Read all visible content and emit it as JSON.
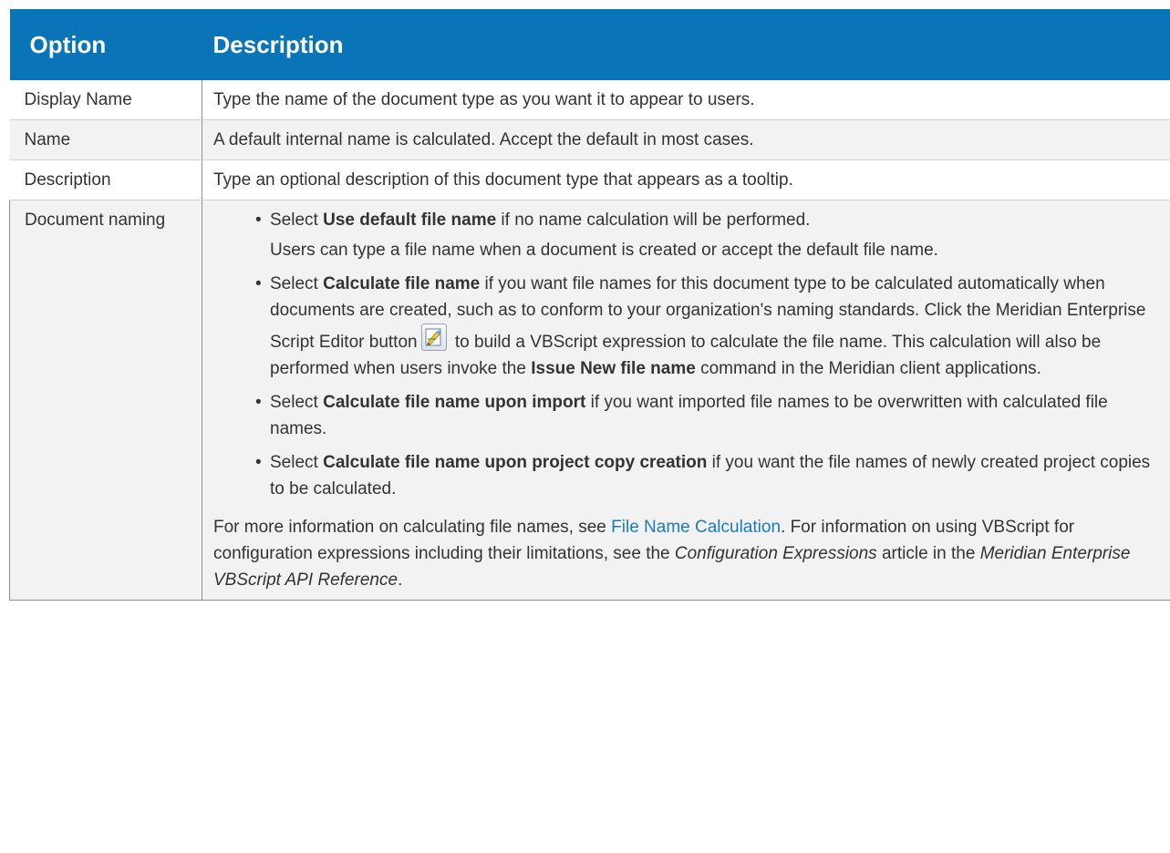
{
  "header": {
    "option": "Option",
    "description": "Description"
  },
  "rows": [
    {
      "option": "Display Name",
      "description": "Type the name of the document type as you want it to appear to users."
    },
    {
      "option": "Name",
      "description": "A default internal name is calculated. Accept the default in most cases."
    },
    {
      "option": "Description",
      "description": "Type an optional description of this document type that appears as a tooltip."
    }
  ],
  "naming": {
    "option": "Document naming",
    "b1_pre": "Select ",
    "b1_bold": "Use default file name",
    "b1_post": " if no name calculation will be performed.",
    "b1_sub": "Users can type a file name when a document is created or accept the default file name.",
    "b2_pre": "Select ",
    "b2_bold": "Calculate file name",
    "b2_mid": " if you want file names for this document type to be calculated automatically when documents are created, such as to conform to your organization's naming standards. Click the Meridian Enterprise Script Editor button",
    "b2_post": " to build a VBScript expression to calculate the file name. This calculation will also be performed when users invoke the ",
    "b2_bold2": "Issue New file name",
    "b2_end": " command in the Meridian client applications.",
    "b3_pre": "Select ",
    "b3_bold": "Calculate file name upon import",
    "b3_post": " if you want imported file names to be overwritten with calculated file names.",
    "b4_pre": "Select ",
    "b4_bold": "Calculate file name upon project copy creation",
    "b4_post": "  if you want the file names of newly created project copies to be calculated.",
    "para_pre": "For more information on calculating file names, see ",
    "para_link": "File Name Calculation",
    "para_mid": ".  For information on using VBScript for configuration expressions including their limitations, see the ",
    "para_italic1": "Configuration Expressions",
    "para_mid2": " article in the ",
    "para_italic2": "Meridian Enterprise VBScript API Reference",
    "para_end": "."
  },
  "icons": {
    "script_editor": "script-editor-icon"
  },
  "colors": {
    "header_bg": "#0a74b8",
    "link": "#1b7bc2",
    "stripe": "#f2f2f2"
  }
}
